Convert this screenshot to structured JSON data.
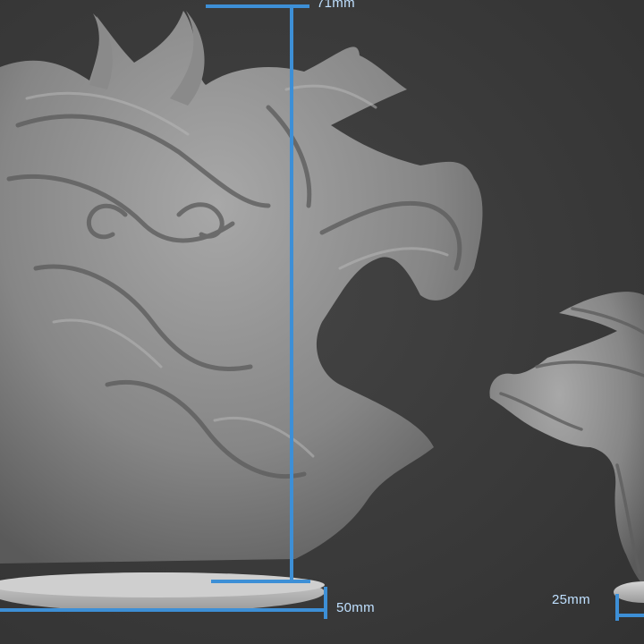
{
  "measurements": {
    "height_label": "71mm",
    "large_base_label": "50mm",
    "small_base_label": "25mm"
  },
  "colors": {
    "background": "#3a3a3a",
    "sculpt": "#8c8c8c",
    "sculpt_shadow": "#5e5e5e",
    "sculpt_highlight": "#b4b4b4",
    "base": "#c2c2c2",
    "measure_line": "#3d8fd6",
    "measure_text": "#bfe0ff"
  }
}
